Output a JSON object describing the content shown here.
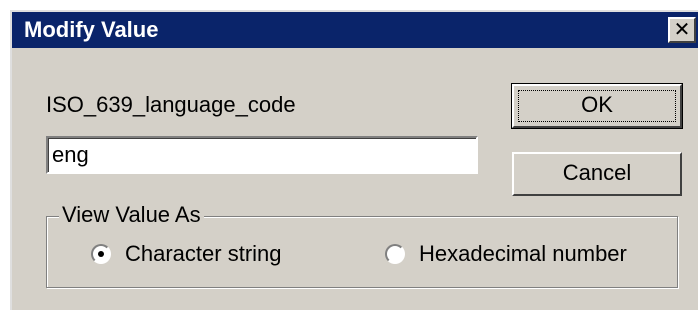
{
  "window": {
    "title": "Modify Value",
    "close_glyph": "✕",
    "close_icon": "close-icon"
  },
  "field": {
    "label": "ISO_639_language_code",
    "value": "eng"
  },
  "buttons": {
    "ok_label": "OK",
    "cancel_label": "Cancel"
  },
  "view_as": {
    "legend": "View Value As",
    "options": [
      {
        "label": "Character string",
        "selected": true
      },
      {
        "label": "Hexadecimal number",
        "selected": false
      }
    ]
  },
  "colors": {
    "titlebar": "#0a246a",
    "face": "#d4d0c8"
  }
}
